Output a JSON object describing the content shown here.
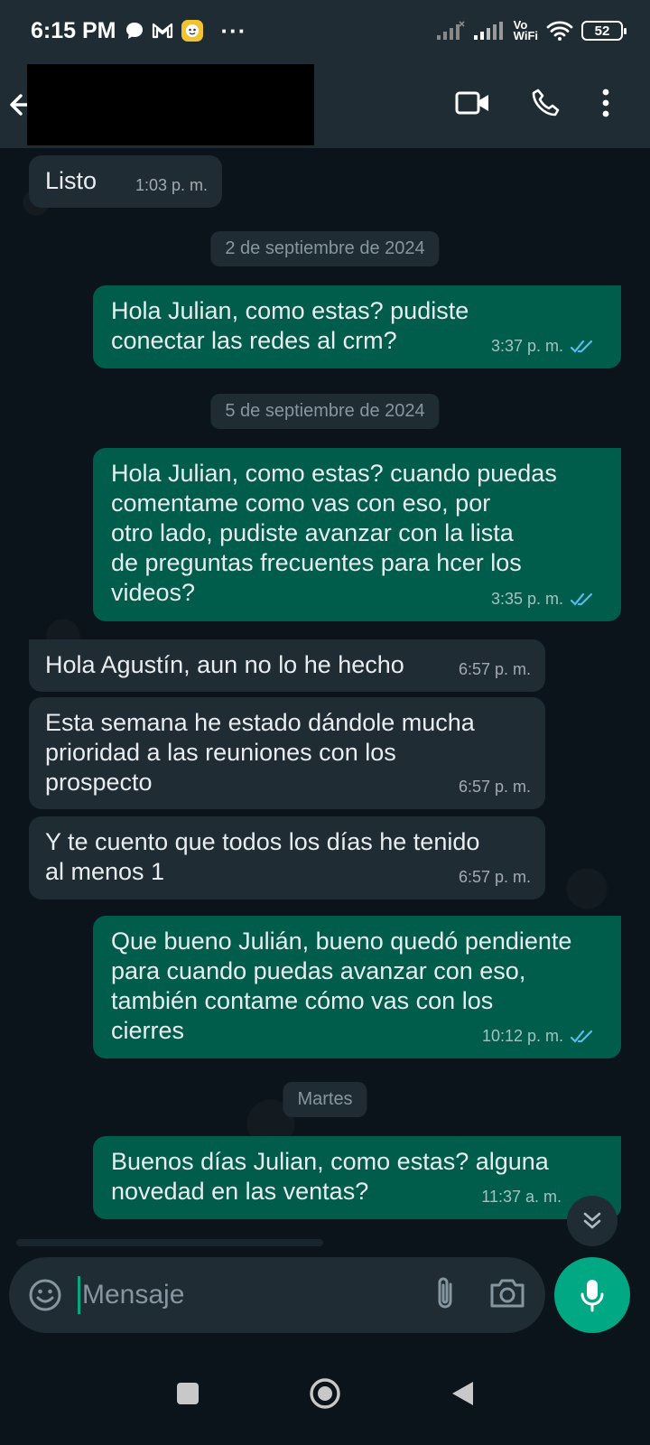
{
  "status_bar": {
    "time": "6:15 PM",
    "vowifi_top": "Vo",
    "vowifi_bottom": "WiFi",
    "battery": "52",
    "more": "···"
  },
  "header": {
    "contact_name_redacted": true
  },
  "colors": {
    "accent": "#00a884",
    "outgoing_bubble": "#005c4b",
    "incoming_bubble": "#1f2c34",
    "read_tick": "#53bdeb"
  },
  "messages": [
    {
      "direction": "in",
      "text": "Listo",
      "time": "1:03 p. m."
    },
    {
      "type": "date",
      "text": "2 de septiembre de 2024"
    },
    {
      "direction": "out",
      "text": "Hola Julian, como estas? pudiste\nconectar las redes al crm?",
      "time": "3:37 p. m.",
      "status": "read"
    },
    {
      "type": "date",
      "text": "5 de septiembre de 2024"
    },
    {
      "direction": "out",
      "text": "Hola Julian, como estas? cuando puedas\ncomentame como vas con eso, por\notro lado, pudiste avanzar con la lista\nde preguntas frecuentes para hcer los\nvideos?",
      "time": "3:35 p. m.",
      "status": "read"
    },
    {
      "direction": "in",
      "text": "Hola Agustín, aun no lo he hecho",
      "time": "6:57 p. m."
    },
    {
      "direction": "in",
      "text": "Esta semana he estado dándole mucha\nprioridad a las reuniones con los\nprospecto",
      "time": "6:57 p. m."
    },
    {
      "direction": "in",
      "text": "Y te cuento que todos los días he tenido\nal menos 1",
      "time": "6:57 p. m."
    },
    {
      "direction": "out",
      "text": "Que bueno Julián, bueno quedó pendiente\npara cuando puedas avanzar con eso,\ntambién contame cómo vas con los\ncierres",
      "time": "10:12 p. m.",
      "status": "read"
    },
    {
      "type": "date",
      "text": "Martes"
    },
    {
      "direction": "out",
      "text": "Buenos días Julian, como estas? alguna\nnovedad en las ventas?",
      "time": "11:37 a. m.",
      "status": "pending"
    }
  ],
  "composer": {
    "placeholder": "Mensaje"
  }
}
